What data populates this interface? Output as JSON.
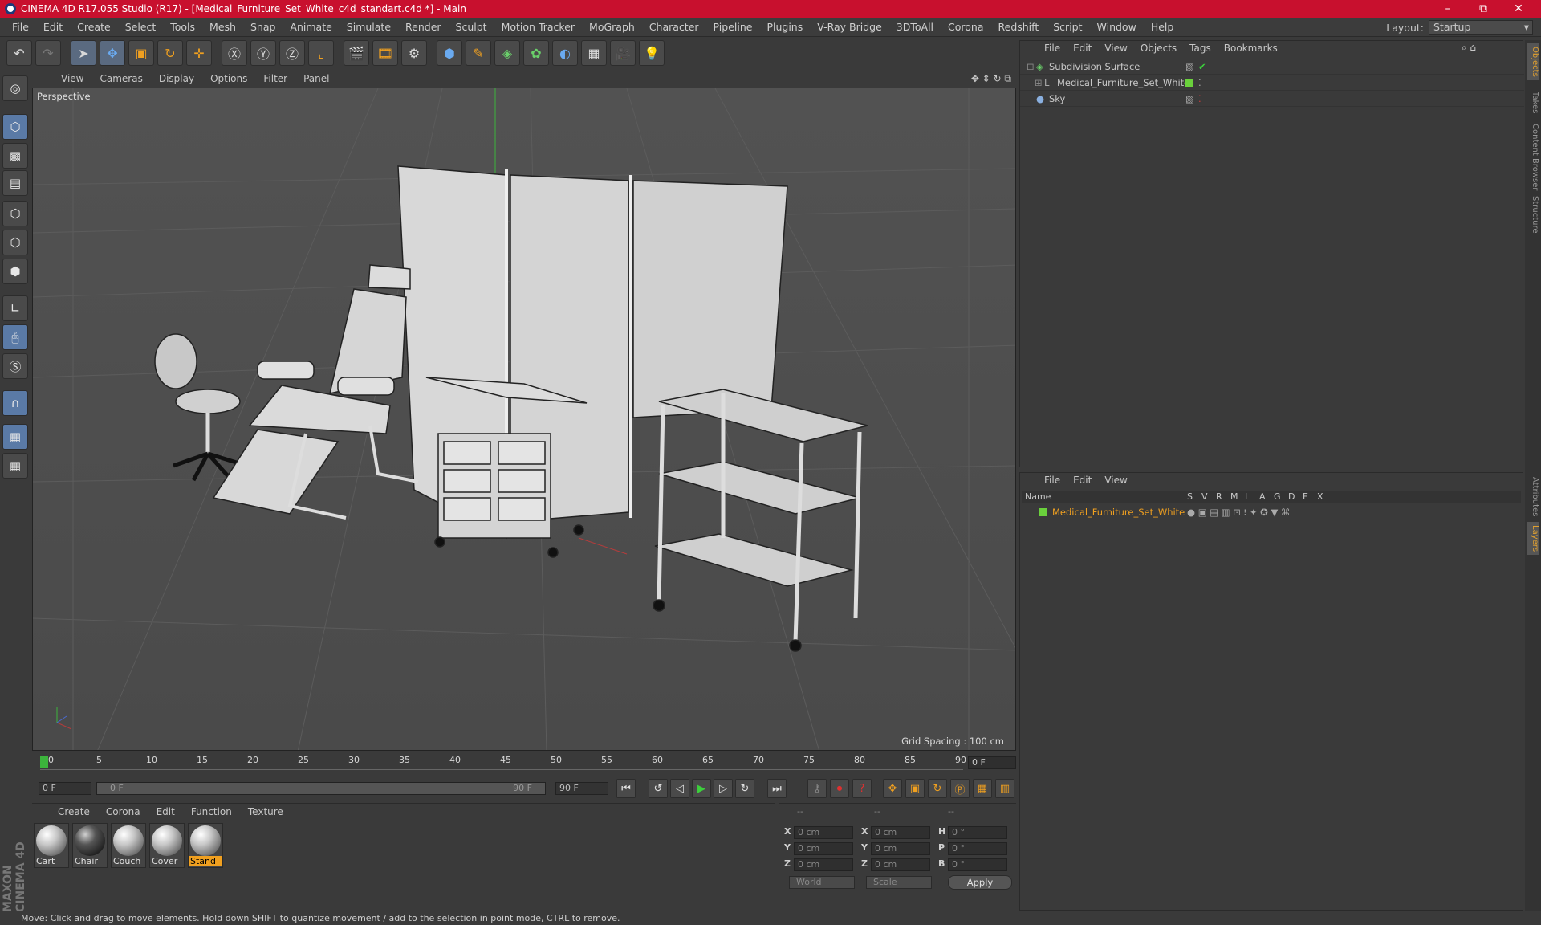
{
  "window": {
    "title": "CINEMA 4D R17.055 Studio (R17) - [Medical_Furniture_Set_White_c4d_standart.c4d *] - Main",
    "minimize": "–",
    "restore": "⧉",
    "close": "✕"
  },
  "menu": [
    "File",
    "Edit",
    "Create",
    "Select",
    "Tools",
    "Mesh",
    "Snap",
    "Animate",
    "Simulate",
    "Render",
    "Sculpt",
    "Motion Tracker",
    "MoGraph",
    "Character",
    "Pipeline",
    "Plugins",
    "V-Ray Bridge",
    "3DToAll",
    "Corona",
    "Redshift",
    "Script",
    "Window",
    "Help"
  ],
  "layout": {
    "label": "Layout:",
    "value": "Startup"
  },
  "viewport": {
    "menu": [
      "View",
      "Cameras",
      "Display",
      "Options",
      "Filter",
      "Panel"
    ],
    "label": "Perspective",
    "grid_spacing": "Grid Spacing : 100 cm"
  },
  "timeline": {
    "ticks": [
      "0",
      "5",
      "10",
      "15",
      "20",
      "25",
      "30",
      "35",
      "40",
      "45",
      "50",
      "55",
      "60",
      "65",
      "70",
      "75",
      "80",
      "85",
      "90"
    ],
    "frame": "0 F",
    "start": "0 F",
    "range_start": "0 F",
    "range_end": "90 F",
    "end": "90 F"
  },
  "materials": {
    "menu": [
      "Create",
      "Corona",
      "Edit",
      "Function",
      "Texture"
    ],
    "items": [
      {
        "label": "Cart"
      },
      {
        "label": "Chair"
      },
      {
        "label": "Couch"
      },
      {
        "label": "Cover"
      },
      {
        "label": "Stand"
      }
    ]
  },
  "coords": {
    "header": [
      "--",
      "--",
      "--"
    ],
    "rows": [
      {
        "a": "X",
        "av": "0 cm",
        "b": "X",
        "bv": "0 cm",
        "c": "H",
        "cv": "0 °"
      },
      {
        "a": "Y",
        "av": "0 cm",
        "b": "Y",
        "bv": "0 cm",
        "c": "P",
        "cv": "0 °"
      },
      {
        "a": "Z",
        "av": "0 cm",
        "b": "Z",
        "bv": "0 cm",
        "c": "B",
        "cv": "0 °"
      }
    ],
    "world": "World",
    "scale": "Scale",
    "apply": "Apply"
  },
  "objects": {
    "menu": [
      "File",
      "Edit",
      "View",
      "Objects",
      "Tags",
      "Bookmarks"
    ],
    "items": [
      {
        "name": "Subdivision Surface"
      },
      {
        "name": "Medical_Furniture_Set_White"
      },
      {
        "name": "Sky"
      }
    ]
  },
  "layers": {
    "menu": [
      "File",
      "Edit",
      "View"
    ],
    "columns": [
      "Name",
      "S",
      "V",
      "R",
      "M",
      "L",
      "A",
      "G",
      "D",
      "E",
      "X"
    ],
    "items": [
      {
        "name": "Medical_Furniture_Set_White"
      }
    ]
  },
  "side_tabs": [
    "Objects",
    "Takes",
    "Content Browser",
    "Structure",
    "Attributes",
    "Layers"
  ],
  "status": "Move: Click and drag to move elements. Hold down SHIFT to quantize movement / add to the selection in point mode, CTRL to remove.",
  "brand": "MAXON CINEMA 4D",
  "colors": {
    "title_bar": "#c8102e",
    "accent": "#f0a020",
    "viewport_bg": "#4f4f4f"
  }
}
